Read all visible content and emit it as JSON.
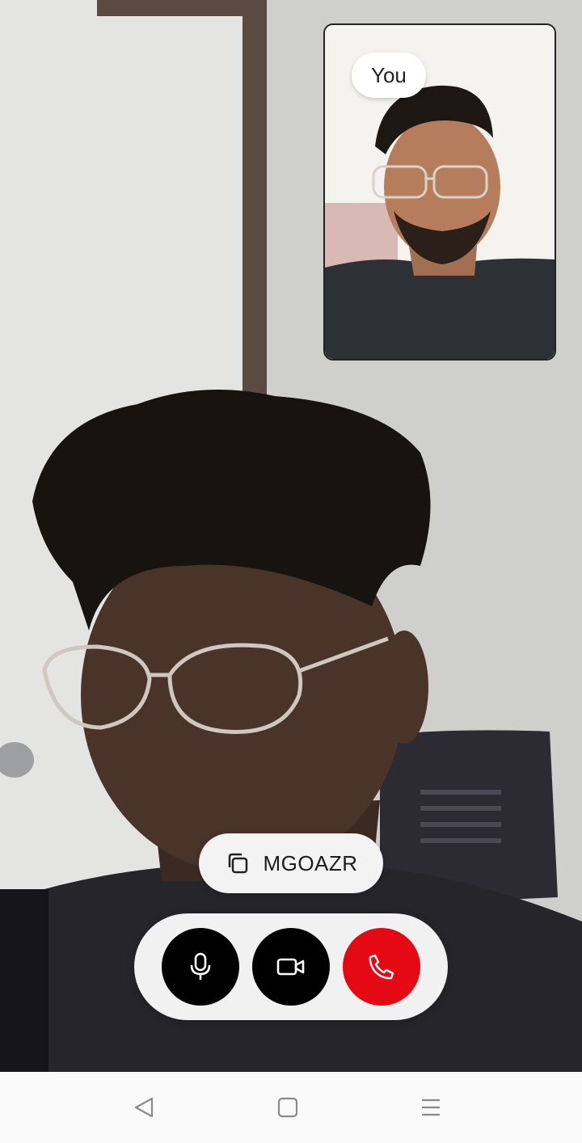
{
  "call": {
    "self_label": "You",
    "meeting_code": "MGOAZR"
  },
  "controls": {
    "microphone": "microphone-icon",
    "camera": "video-camera-icon",
    "end_call": "phone-icon",
    "end_call_color": "#e50914"
  },
  "nav": {
    "back": "back-triangle-icon",
    "home": "home-square-icon",
    "recents": "menu-lines-icon"
  }
}
